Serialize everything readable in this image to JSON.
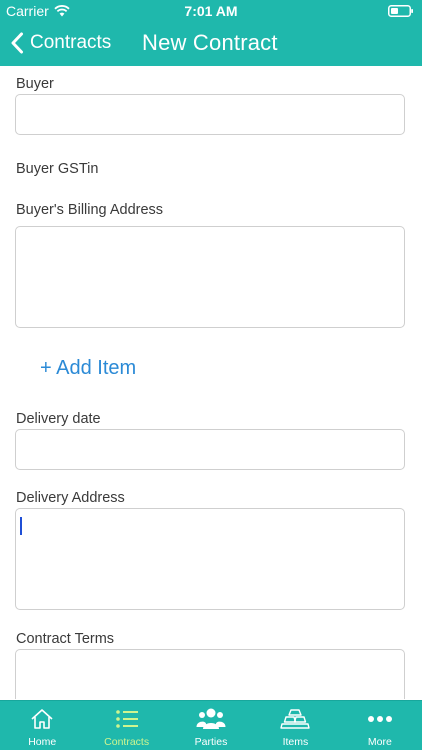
{
  "status_bar": {
    "carrier": "Carrier",
    "time": "7:01 AM",
    "wifi_icon": "wifi-icon",
    "battery_icon": "battery-icon"
  },
  "nav": {
    "back_label": "Contracts",
    "back_icon": "chevron-left-icon",
    "title": "New Contract"
  },
  "form": {
    "buyer_label": "Buyer",
    "buyer_value": "",
    "buyer_gstin_label": "Buyer GSTin",
    "billing_address_label": "Buyer's Billing Address",
    "billing_address_value": "",
    "add_item_label": "+ Add Item",
    "delivery_date_label": "Delivery date",
    "delivery_date_value": "",
    "delivery_address_label": "Delivery Address",
    "delivery_address_value": "",
    "contract_terms_label": "Contract Terms",
    "contract_terms_value": ""
  },
  "tab_bar": {
    "active_tab": "Contracts",
    "tabs": [
      {
        "label": "Home",
        "icon": "home-icon"
      },
      {
        "label": "Contracts",
        "icon": "list-icon"
      },
      {
        "label": "Parties",
        "icon": "people-icon"
      },
      {
        "label": "Items",
        "icon": "stacked-bars-icon"
      },
      {
        "label": "More",
        "icon": "more-dots-icon"
      }
    ]
  },
  "colors": {
    "primary": "#1fb8ac",
    "active_tab": "#cdf58f",
    "link": "#2b8ad6",
    "caret": "#1f4fd6"
  }
}
